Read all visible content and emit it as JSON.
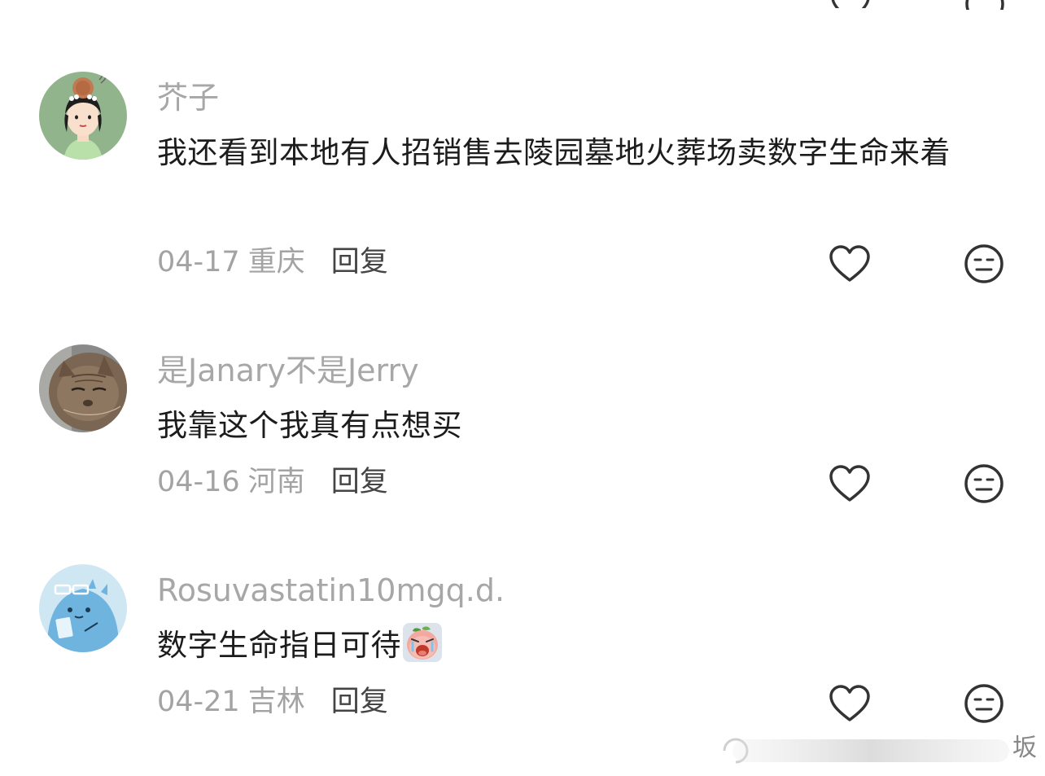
{
  "comments": [
    {
      "username": "芥子",
      "text": "我还看到本地有人招销售去陵园墓地火葬场卖数字生命来着",
      "date": "04-17",
      "location": "重庆",
      "reply_label": "回复",
      "avatar": "cartoon-woman-avatar"
    },
    {
      "username": "是Janary不是Jerry",
      "text": "我靠这个我真有点想买",
      "date": "04-16",
      "location": "河南",
      "reply_label": "回复",
      "avatar": "cat-photo-avatar"
    },
    {
      "username": "Rosuvastatin10mgq.d.",
      "text": "数字生命指日可待",
      "emoji": "crying-peach-emoji",
      "date": "04-21",
      "location": "吉林",
      "reply_label": "回复",
      "avatar": "blue-cartoon-avatar"
    }
  ],
  "icons": {
    "like": "heart-icon",
    "reaction": "neutral-face-icon"
  },
  "watermark": {
    "text": "坂"
  },
  "colors": {
    "username": "#a7a7a7",
    "meta": "#a3a3a3",
    "reply": "#444444",
    "icon_stroke": "#333333"
  }
}
